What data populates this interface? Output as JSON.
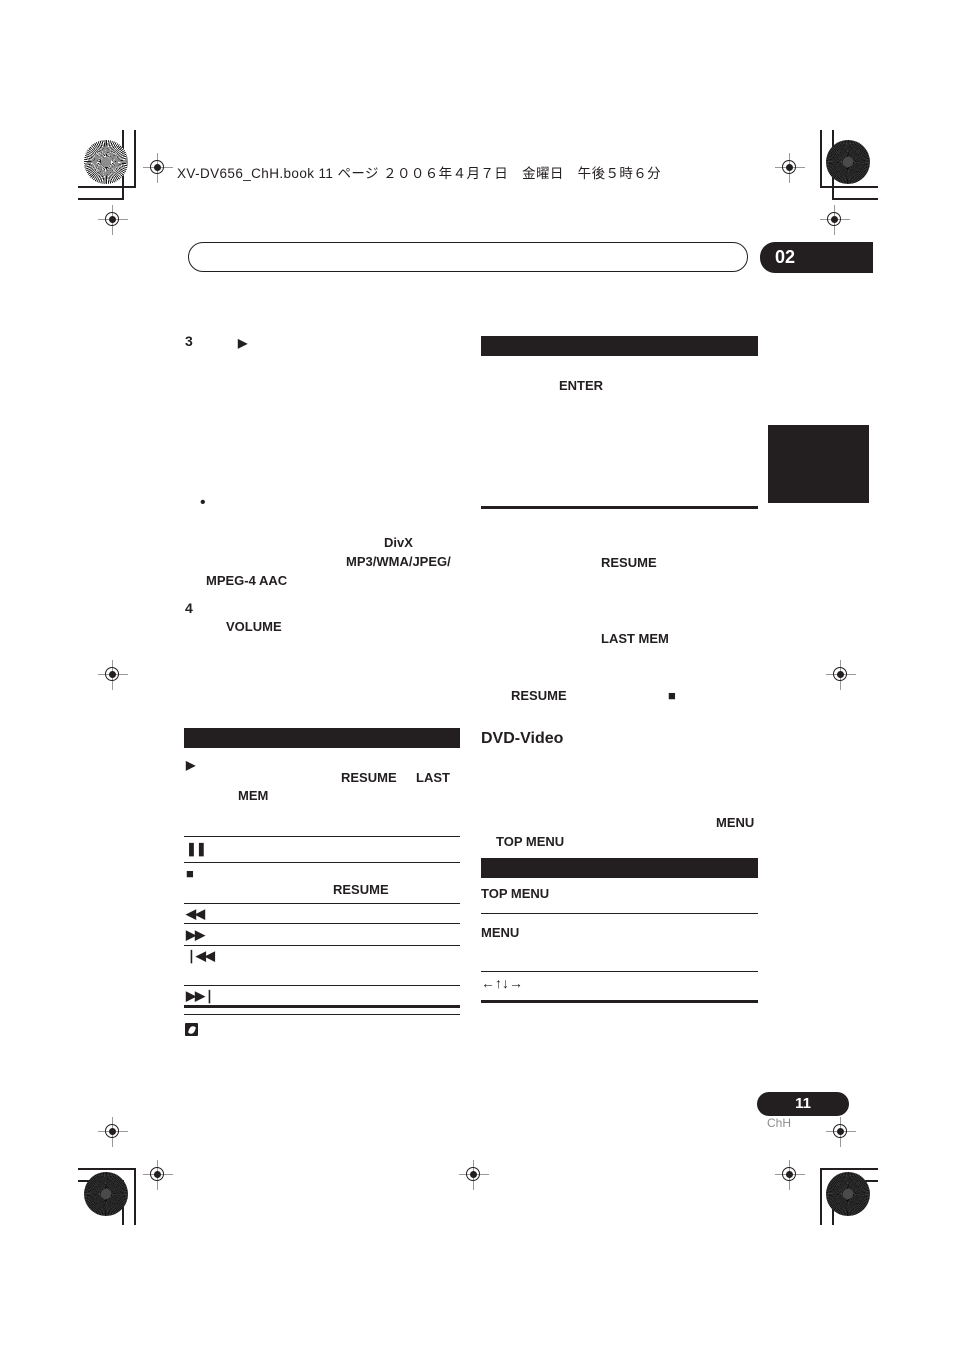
{
  "document": {
    "filestamp": "XV-DV656_ChH.book  11 ページ  ２００６年４月７日　金曜日　午後５時６分",
    "chapter_badge": "02",
    "header_title": "",
    "page_number": "11",
    "page_language": "ChH"
  },
  "left_column": {
    "step3": {
      "number": "3",
      "play_icon": "▶",
      "bullet": "•",
      "terms": {
        "divx": "DivX",
        "mp3_wma_jpeg": "MP3/WMA/JPEG/",
        "mpeg4_aac": "MPEG-4 AAC"
      }
    },
    "step4": {
      "number": "4",
      "volume": "VOLUME"
    },
    "playback_section": {
      "heading": "",
      "intro": {
        "play_icon": "▶",
        "resume": "RESUME",
        "last": "LAST",
        "mem": "MEM"
      },
      "rows": [
        {
          "icon": "❚❚",
          "icon_name": "pause-icon",
          "note": ""
        },
        {
          "icon": "■",
          "icon_name": "stop-icon",
          "note": "RESUME"
        },
        {
          "icon": "◀◀",
          "icon_name": "rewind-icon",
          "note": ""
        },
        {
          "icon": "▶▶",
          "icon_name": "fast-forward-icon",
          "note": ""
        },
        {
          "icon": "❘◀◀",
          "icon_name": "previous-track-icon",
          "note": ""
        },
        {
          "icon": "▶▶❘",
          "icon_name": "next-track-icon",
          "note": ""
        }
      ],
      "note_marker": ""
    }
  },
  "right_column": {
    "top_section": {
      "heading": "",
      "enter": "ENTER"
    },
    "resume_section": {
      "resume": "RESUME",
      "last_mem": "LAST MEM",
      "resume2": "RESUME",
      "stop_icon": "■",
      "dvd_video": "DVD-Video"
    },
    "menu_section": {
      "menu": "MENU",
      "top_menu_inline": "TOP MENU",
      "heading": "",
      "rows": [
        {
          "label": "TOP MENU",
          "name": "top-menu-row"
        },
        {
          "label": "MENU",
          "name": "menu-row"
        },
        {
          "label": "←↑↓→",
          "name": "cursor-keys-row"
        }
      ]
    }
  }
}
